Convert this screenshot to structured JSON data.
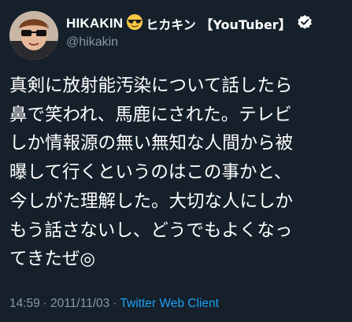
{
  "user": {
    "display_name": "HIKAKIN",
    "emoji_icon": "sunglasses-face-icon",
    "display_name_suffix": "ヒカキン 【YouTuber】",
    "verified_icon": "verified-badge-icon",
    "handle": "@hikakin"
  },
  "tweet": {
    "lines": [
      "真剣に放射能汚染について話したら",
      "鼻で笑われ、馬鹿にされた。テレビ",
      "しか情報源の無い無知な人間から被",
      "曝して行くというのはこの事かと、",
      "今しがた理解した。大切な人にしか",
      "もう話さないし、どうでもよくなっ",
      "てきたぜ◎"
    ]
  },
  "meta": {
    "time": "14:59",
    "separator": "·",
    "date": "2011/11/03",
    "client": "Twitter Web Client"
  },
  "colors": {
    "background": "#15202b",
    "text": "#ffffff",
    "secondary": "#8899a6",
    "link": "#1da1f2"
  }
}
